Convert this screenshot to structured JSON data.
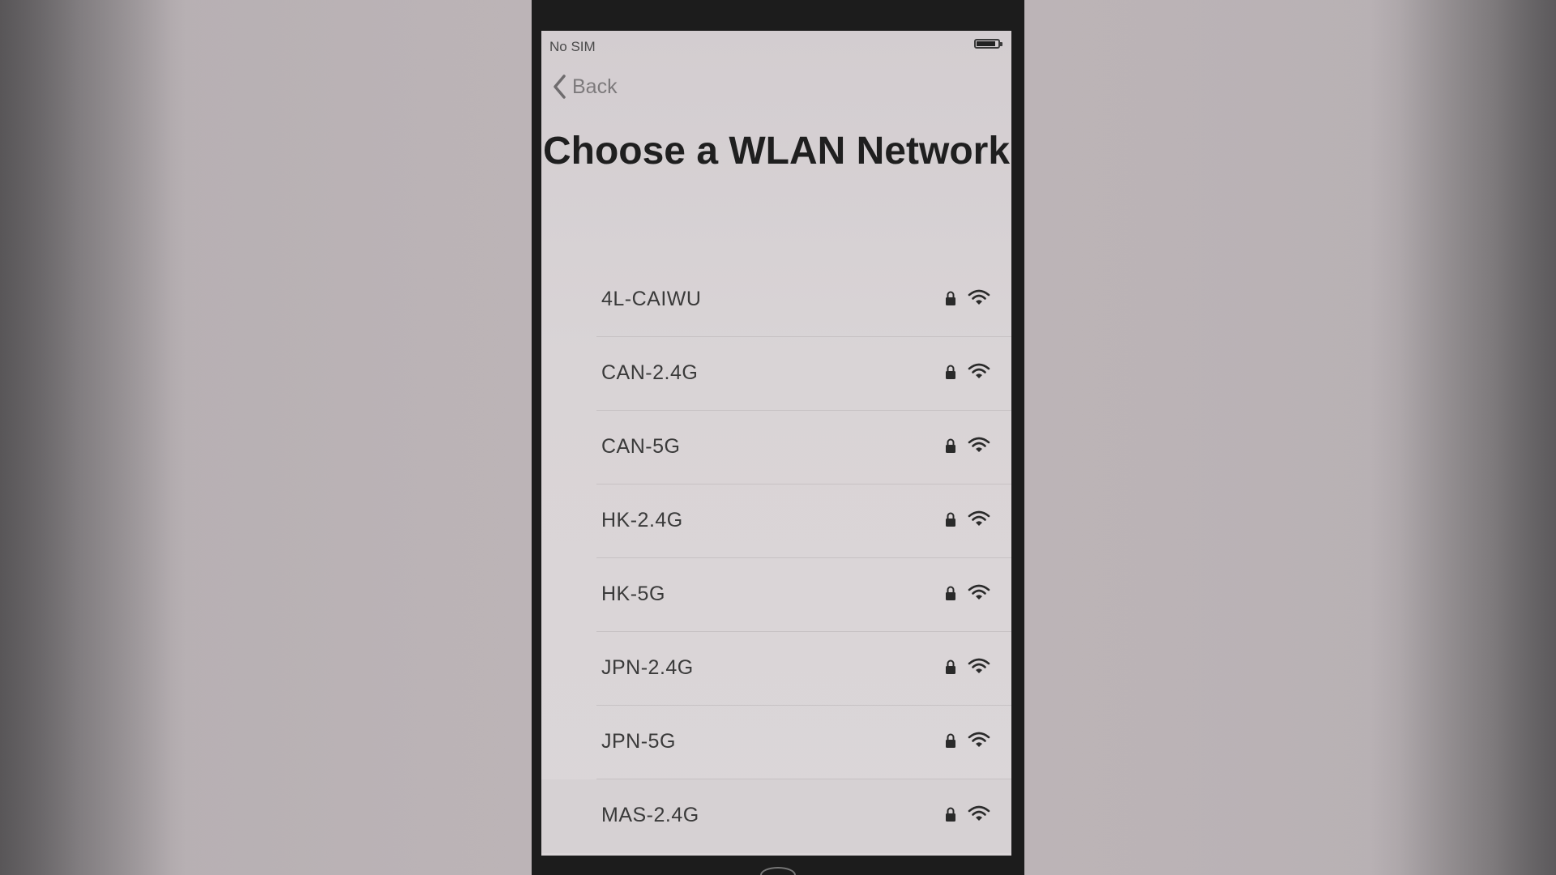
{
  "status_bar": {
    "carrier": "No SIM",
    "battery_icon": "battery-icon"
  },
  "nav": {
    "back_label": "Back",
    "back_icon": "chevron-left-icon"
  },
  "title": "Choose a WLAN Network",
  "networks": [
    {
      "name": "4L-CAIWU",
      "secured": true
    },
    {
      "name": "CAN-2.4G",
      "secured": true
    },
    {
      "name": "CAN-5G",
      "secured": true
    },
    {
      "name": "HK-2.4G",
      "secured": true
    },
    {
      "name": "HK-5G",
      "secured": true
    },
    {
      "name": "JPN-2.4G",
      "secured": true
    },
    {
      "name": "JPN-5G",
      "secured": true
    },
    {
      "name": "MAS-2.4G",
      "secured": true
    }
  ],
  "icons": {
    "lock": "lock-icon",
    "wifi": "wifi-icon"
  },
  "colors": {
    "screen_background": "#d9d4d6",
    "title_text": "#1f1f1f",
    "back_text": "#7d7a7c",
    "phone_frame": "#1c1c1c"
  }
}
